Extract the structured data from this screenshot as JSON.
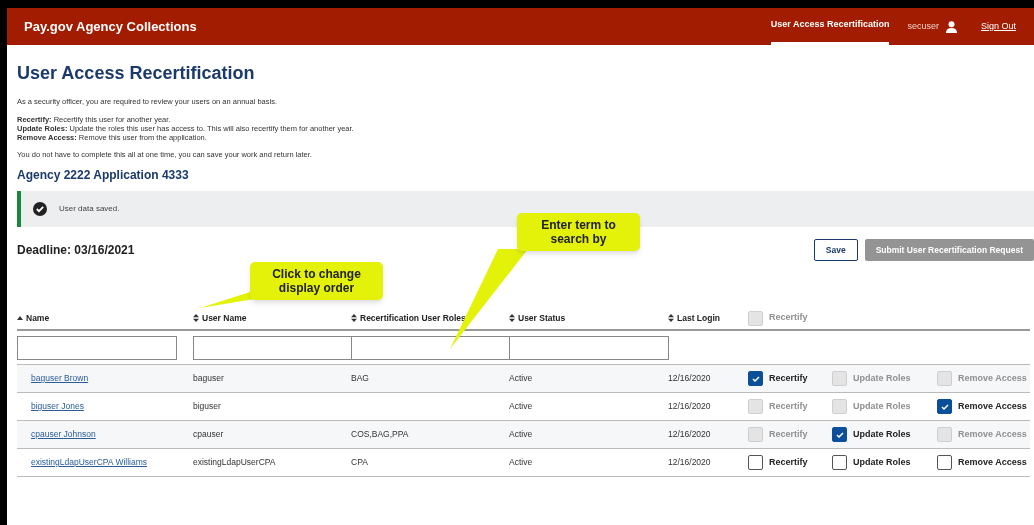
{
  "header": {
    "brand": "Pay.gov Agency Collections",
    "nav": [
      {
        "label": "User Access Recertification",
        "selected": true
      }
    ],
    "username": "secuser",
    "sign_out": "Sign Out"
  },
  "title": "User Access Recertification",
  "intro": "As a security officer, you are required to review your users on an annual basis.",
  "definitions": [
    "**Recertify:** Recertify this user for another year.",
    "**Update Roles:** Update the roles this user has access to. This will also recertify them for another year.",
    "**Remove Access:** Remove this user from the application."
  ],
  "note": "You do not have to complete this all at one time, you can save your work and return later.",
  "subtitle": "Agency 2222 Application 4333",
  "alert": {
    "message": "User data saved."
  },
  "deadline": "Deadline: 03/16/2021",
  "buttons": [
    {
      "label": "Save",
      "disabled": false
    },
    {
      "label": "Submit User Recertification Request",
      "disabled": true
    }
  ],
  "table": {
    "columns": [
      {
        "label": "Name",
        "sorted": true,
        "filter": true
      },
      {
        "label": "User Name",
        "sorted": false,
        "filter": true
      },
      {
        "label": "Recertification User Roles",
        "sorted": false,
        "filter": true
      },
      {
        "label": "User Status",
        "sorted": false,
        "filter": true
      },
      {
        "label": "Last Login",
        "sorted": false,
        "filter": false
      }
    ],
    "select_all": {
      "label": "Recertify",
      "checked": false,
      "disabled": true
    },
    "rows": [
      {
        "name": "baguser Brown",
        "user_name": "baguser",
        "roles": "BAG",
        "status": "Active",
        "last_login": "12/16/2020",
        "actions": [
          {
            "label": "Recertify",
            "checked": true,
            "disabled": false
          },
          {
            "label": "Update Roles",
            "checked": false,
            "disabled": true
          },
          {
            "label": "Remove Access",
            "checked": false,
            "disabled": true
          }
        ]
      },
      {
        "name": "biguser Jones",
        "user_name": "biguser",
        "status": "Active",
        "last_login": "12/16/2020",
        "actions": [
          {
            "label": "Recertify",
            "checked": false,
            "disabled": true
          },
          {
            "label": "Update Roles",
            "checked": false,
            "disabled": true
          },
          {
            "label": "Remove Access",
            "checked": true,
            "disabled": false
          }
        ]
      },
      {
        "name": "cpauser Johnson",
        "user_name": "cpauser",
        "roles": "COS,BAG,PPA",
        "status": "Active",
        "last_login": "12/16/2020",
        "actions": [
          {
            "label": "Recertify",
            "checked": false,
            "disabled": true
          },
          {
            "label": "Update Roles",
            "checked": true,
            "disabled": false
          },
          {
            "label": "Remove Access",
            "checked": false,
            "disabled": true
          }
        ]
      },
      {
        "name": "existingLdapUserCPA Williams",
        "user_name": "existingLdapUserCPA",
        "roles": "CPA",
        "status": "Active",
        "last_login": "12/16/2020",
        "actions": [
          {
            "label": "Recertify",
            "checked": false,
            "disabled": false
          },
          {
            "label": "Update Roles",
            "checked": false,
            "disabled": false
          },
          {
            "label": "Remove Access",
            "checked": false,
            "disabled": false
          }
        ]
      }
    ]
  },
  "callouts": [
    {
      "text": "Click to change display order"
    },
    {
      "text": "Enter term to search by"
    }
  ]
}
